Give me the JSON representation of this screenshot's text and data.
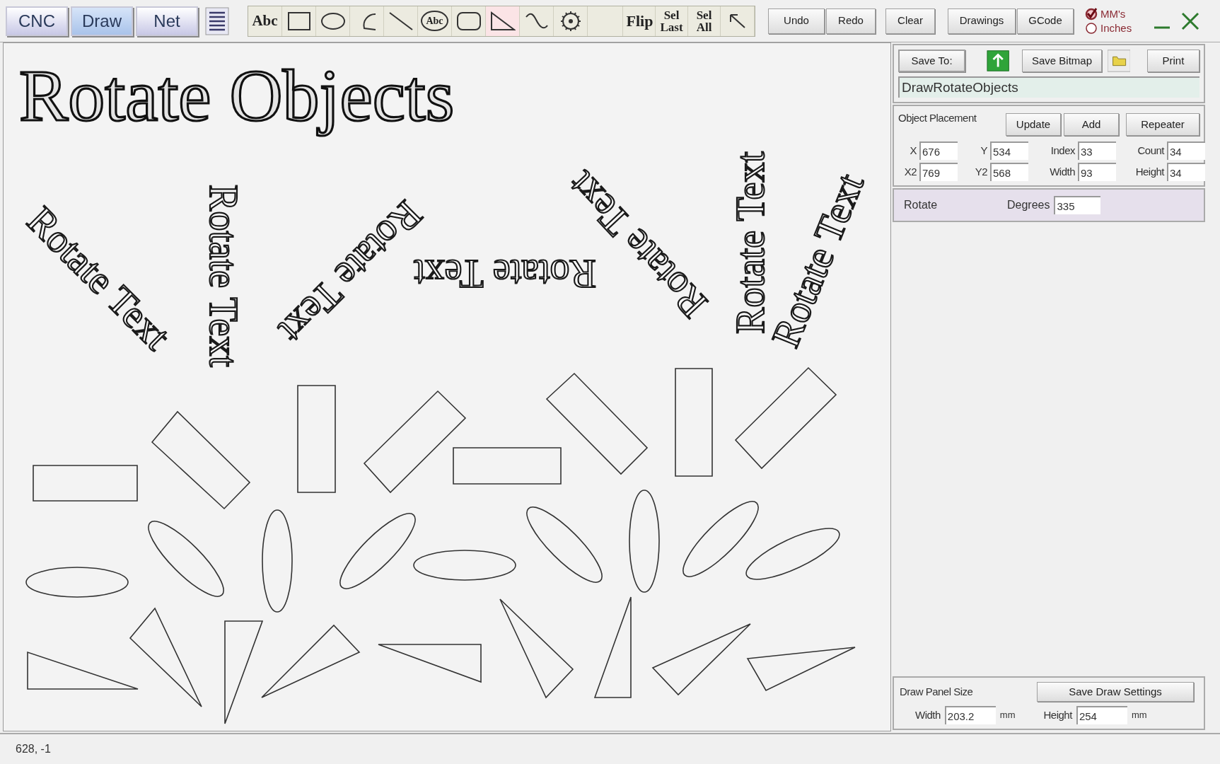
{
  "tabs": [
    {
      "label": "CNC",
      "selected": false
    },
    {
      "label": "Draw",
      "selected": true
    },
    {
      "label": "Net",
      "selected": false
    }
  ],
  "tools": [
    {
      "kind": "text",
      "label": "Abc",
      "selected": false
    },
    {
      "kind": "rectangle",
      "selected": false
    },
    {
      "kind": "ellipse",
      "selected": false
    },
    {
      "kind": "arc",
      "selected": false
    },
    {
      "kind": "line",
      "selected": false
    },
    {
      "kind": "circled-text",
      "label": "Abc",
      "selected": false
    },
    {
      "kind": "rounded-rectangle",
      "selected": false
    },
    {
      "kind": "triangle",
      "selected": true
    },
    {
      "kind": "curve",
      "selected": false
    },
    {
      "kind": "gear",
      "selected": false
    },
    {
      "kind": "blank",
      "selected": false
    },
    {
      "kind": "label",
      "label": "Flip",
      "selected": false
    },
    {
      "kind": "label",
      "label": "Sel Last",
      "selected": false
    },
    {
      "kind": "label",
      "label": "Sel All",
      "selected": false
    },
    {
      "kind": "pointer",
      "selected": false
    }
  ],
  "buttons": [
    "Undo",
    "Redo",
    "Clear",
    "Drawings",
    "GCode"
  ],
  "units": [
    {
      "label": "MM's",
      "selected": true
    },
    {
      "label": "Inches",
      "selected": false
    }
  ],
  "canvas": {
    "title": "Rotate Objects",
    "rotated_texts": [
      "Rotate Text",
      "Rotate Text",
      "Rotate Text",
      "Rotate Text",
      "Rotate Text",
      "Rotate Text",
      "Rotate Text"
    ]
  },
  "save": {
    "save_to": "Save To:",
    "save_bitmap": "Save Bitmap",
    "print": "Print",
    "file_name": "DrawRotateObjects"
  },
  "placement": {
    "title": "Object Placement",
    "buttons": [
      "Update",
      "Add",
      "Repeater"
    ],
    "fields": [
      {
        "label": "X",
        "value": "676"
      },
      {
        "label": "Y",
        "value": "534"
      },
      {
        "label": "Index",
        "value": "33"
      },
      {
        "label": "Count",
        "value": "34"
      },
      {
        "label": "X2",
        "value": "769"
      },
      {
        "label": "Y2",
        "value": "568"
      },
      {
        "label": "Width",
        "value": "93"
      },
      {
        "label": "Height",
        "value": "34"
      }
    ]
  },
  "rotate": {
    "title": "Rotate",
    "label": "Degrees",
    "value": "335"
  },
  "panel_size": {
    "title": "Draw Panel Size",
    "button": "Save Draw Settings",
    "fields": [
      {
        "label": "Width",
        "value": "203.2",
        "unit": "mm"
      },
      {
        "label": "Height",
        "value": "254",
        "unit": "mm"
      }
    ]
  },
  "status_bar": "628, -1"
}
